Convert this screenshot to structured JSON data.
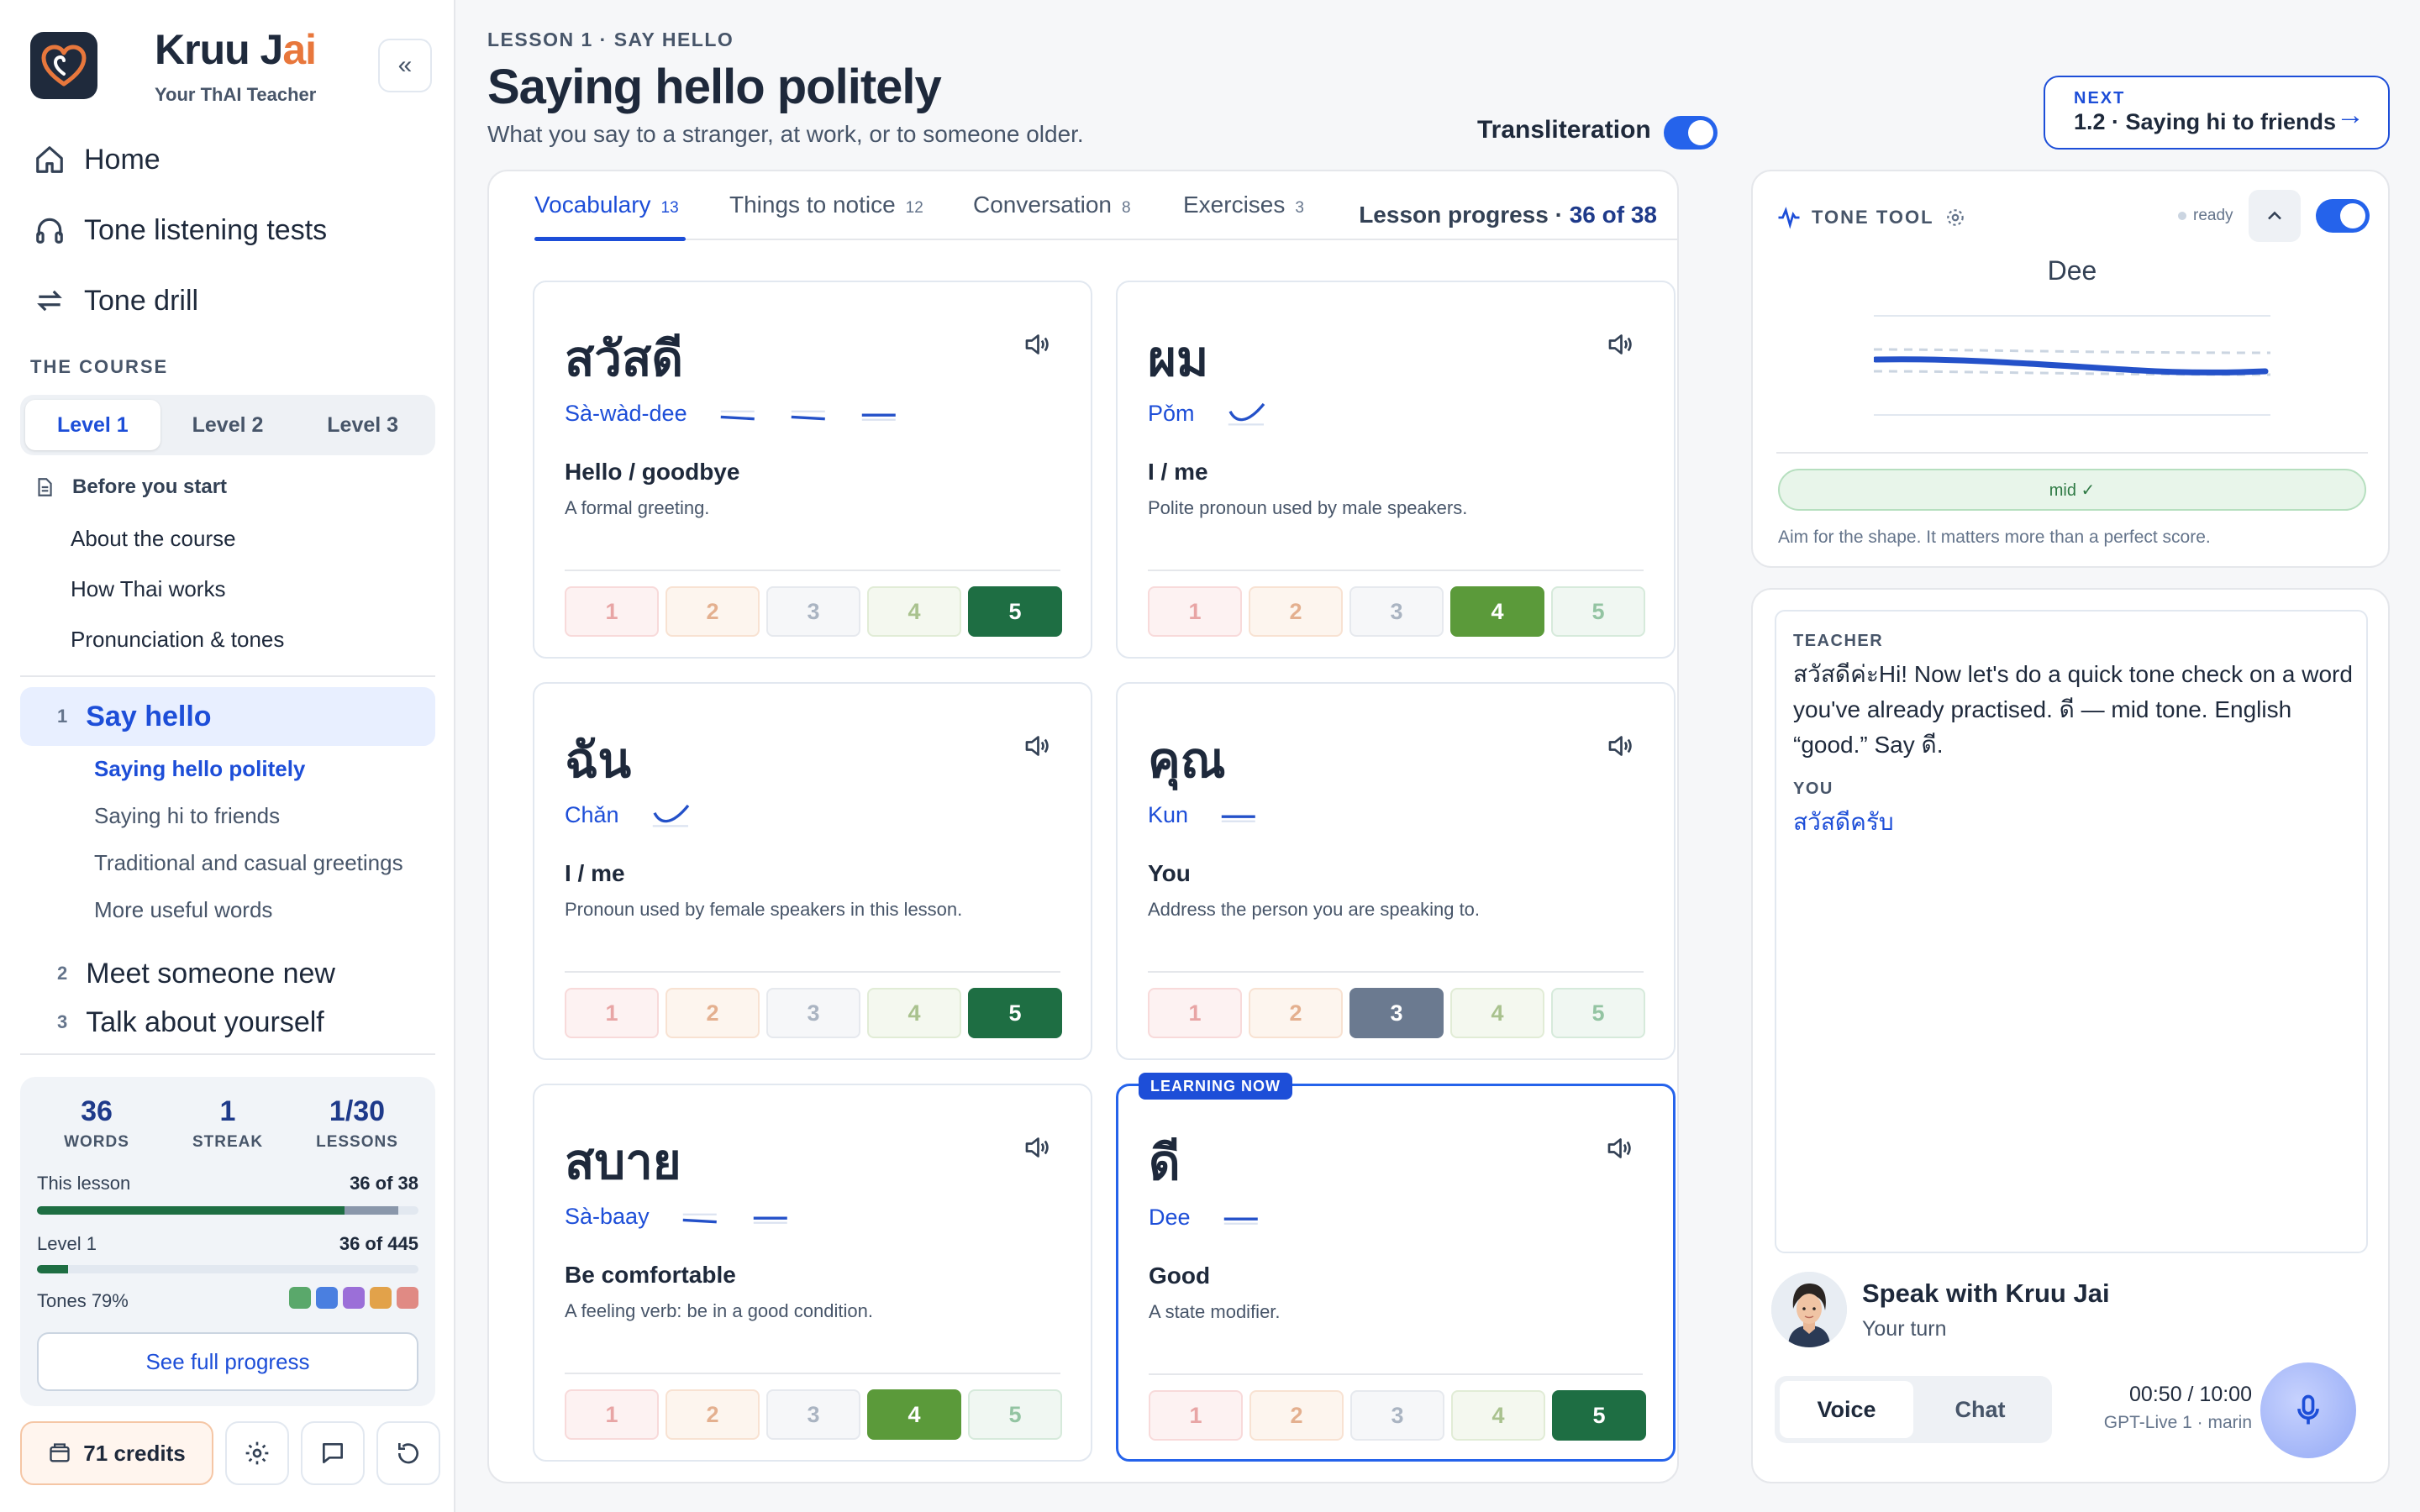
{
  "app": {
    "name_part1": "Kruu J",
    "name_part2": "ai",
    "tagline": "Your ThAI Teacher"
  },
  "nav": [
    {
      "label": "Home",
      "icon": "home-icon"
    },
    {
      "label": "Tone listening tests",
      "icon": "headphones-icon"
    },
    {
      "label": "Tone drill",
      "icon": "repeat-icon"
    }
  ],
  "course": {
    "heading": "THE COURSE",
    "levels": [
      "Level 1",
      "Level 2",
      "Level 3"
    ],
    "active_level": "Level 1",
    "before_start": {
      "label": "Before you start",
      "items": [
        "About the course",
        "How Thai works",
        "Pronunciation & tones"
      ]
    },
    "lessons": [
      {
        "num": "1",
        "title": "Say hello",
        "active": true,
        "subs": [
          "Saying hello politely",
          "Saying hi to friends",
          "Traditional and casual greetings",
          "More useful words"
        ]
      },
      {
        "num": "2",
        "title": "Meet someone new"
      },
      {
        "num": "3",
        "title": "Talk about yourself"
      }
    ]
  },
  "stats": {
    "words": {
      "value": "36",
      "label": "WORDS"
    },
    "streak": {
      "value": "1",
      "label": "STREAK"
    },
    "lessons": {
      "value": "1/30",
      "label": "LESSONS"
    },
    "this_lesson": {
      "label": "This lesson",
      "value": "36 of 38",
      "fraction": 0.947
    },
    "level": {
      "label": "Level 1",
      "value": "36 of 445",
      "fraction": 0.081
    },
    "tones": {
      "label": "Tones 79%",
      "colors": [
        "#5aa86b",
        "#4a7fe0",
        "#9b6fd8",
        "#e2a24a",
        "#e08a84"
      ]
    },
    "full_progress": "See full progress"
  },
  "footer": {
    "credits": "71 credits"
  },
  "header": {
    "breadcrumb": "LESSON 1 · SAY HELLO",
    "title": "Saying hello politely",
    "subtitle": "What you say to a stranger, at work, or to someone older.",
    "transliteration_label": "Transliteration",
    "transliteration_on": true,
    "next_kicker": "NEXT",
    "next_title": "1.2 · Saying hi to friends"
  },
  "tabs": [
    {
      "label": "Vocabulary",
      "count": "13",
      "active": true
    },
    {
      "label": "Things to notice",
      "count": "12"
    },
    {
      "label": "Conversation",
      "count": "8"
    },
    {
      "label": "Exercises",
      "count": "3"
    }
  ],
  "lesson_progress": {
    "label": "Lesson progress · ",
    "value": "36 of 38"
  },
  "cards": [
    {
      "thai": "สวัสดี",
      "roman": "Sà-wàd-dee",
      "tones": [
        "mid-low",
        "mid-low",
        "mid"
      ],
      "meaning": "Hello / goodbye",
      "desc": "A formal greeting.",
      "rating": 5
    },
    {
      "thai": "ผม",
      "roman": "Pǒm",
      "tones": [
        "rising"
      ],
      "meaning": "I / me",
      "desc": "Polite pronoun used by male speakers.",
      "rating": 4
    },
    {
      "thai": "ฉัน",
      "roman": "Chǎn",
      "tones": [
        "rising"
      ],
      "meaning": "I / me",
      "desc": "Pronoun used by female speakers in this lesson.",
      "rating": 5
    },
    {
      "thai": "คุณ",
      "roman": "Kun",
      "tones": [
        "mid"
      ],
      "meaning": "You",
      "desc": "Address the person you are speaking to.",
      "rating": 3
    },
    {
      "thai": "สบาย",
      "roman": "Sà-baay",
      "tones": [
        "mid-low",
        "mid"
      ],
      "meaning": "Be comfortable",
      "desc": "A feeling verb: be in a good condition.",
      "rating": 4
    },
    {
      "thai": "ดี",
      "roman": "Dee",
      "tones": [
        "mid"
      ],
      "meaning": "Good",
      "desc": "A state modifier.",
      "rating": 5,
      "current": true,
      "badge": "LEARNING NOW"
    }
  ],
  "tone_tool": {
    "label": "TONE TOOL",
    "status": "ready",
    "word": "Dee",
    "result": "mid ✓",
    "hint": "Aim for the shape. It matters more than a perfect score.",
    "enabled": true
  },
  "chat": {
    "teacher_label": "TEACHER",
    "teacher_msg": "สวัสดีค่ะHi! Now let's do a quick tone check on a word you've already practised. ดี — mid tone. English “good.” Say ดี.",
    "you_label": "YOU",
    "you_msg": "สวัสดีครับ",
    "speak_title": "Speak with Kruu Jai",
    "speak_sub": "Your turn",
    "modes": [
      "Voice",
      "Chat"
    ],
    "active_mode": "Voice",
    "timer": "00:50 / 10:00",
    "model": "GPT-Live 1 · marin"
  },
  "colors": {
    "accent": "#1d4ed8",
    "brand_orange": "#e8773c",
    "navy": "#1f2a3c",
    "success": "#1e6e43"
  }
}
